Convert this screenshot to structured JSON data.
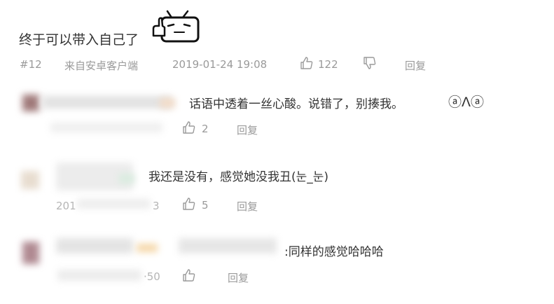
{
  "main_comment": {
    "text": "终于可以带入自己了",
    "floor": "#12",
    "source": "来自安卓客户端",
    "datetime": "2019-01-24 19:08",
    "like_count": "122",
    "reply_label": "回复",
    "emoji": "tv-mascot-thumbsup-icon"
  },
  "replies": [
    {
      "text": "话语中透着一丝心酸。说错了，别揍我。",
      "emoji_text": "ⓐɅⓐ",
      "like_count": "2",
      "reply_label": "回复"
    },
    {
      "text": "我还是没有，感觉她没我丑(눈_눈)",
      "like_count": "5",
      "reply_label": "回复",
      "partial_date": "201",
      "partial_time": "3"
    },
    {
      "text": ":同样的感觉哈哈哈",
      "reply_label": "回复",
      "partial_time": "·50"
    }
  ],
  "colors": {
    "text": "#333333",
    "meta": "#9a9a9a",
    "background": "#ffffff"
  }
}
